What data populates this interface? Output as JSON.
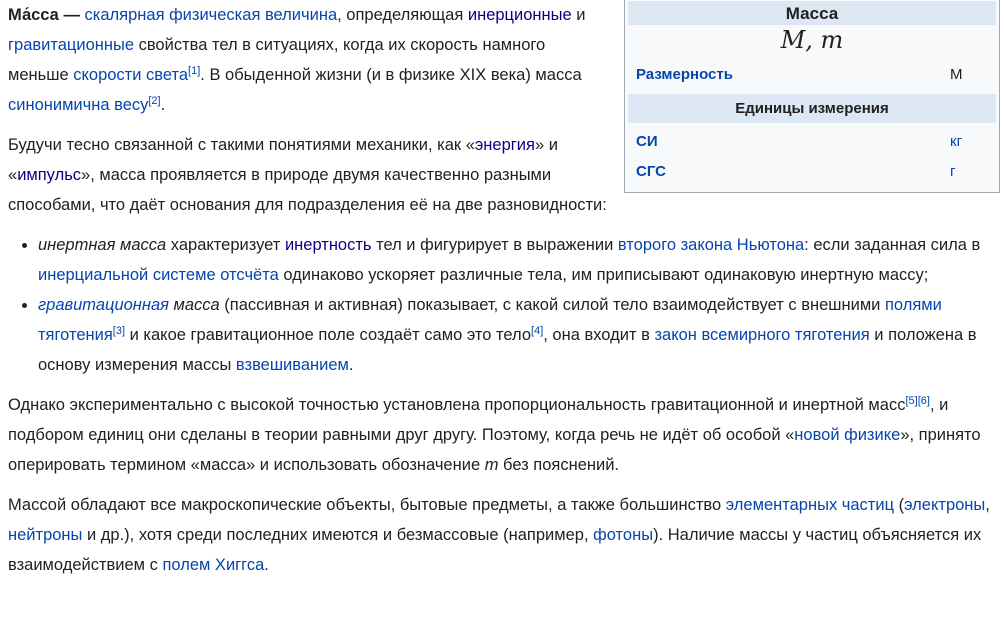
{
  "infobox": {
    "title": "Масса",
    "formula": "M, m",
    "dimension_label": "Размерность",
    "dimension_value": "M",
    "units_header": "Единицы измерения",
    "si_label": "СИ",
    "si_value": "кг",
    "cgs_label": "СГС",
    "cgs_value": "г"
  },
  "p1": {
    "term": "Ма́сса",
    "dash": " — ",
    "link1": "скалярная физическая величина",
    "t1": ", определяющая ",
    "link2": "инерционные",
    "t2": " и ",
    "link3": "гравитационные",
    "t3": " свойства тел в ситуациях, когда их скорость намного меньше ",
    "link4": "скорости света",
    "ref1": "[1]",
    "t4": ". В обыденной жизни (и в физике XIX века) масса ",
    "link5": "синонимична весу",
    "ref2": "[2]",
    "t5": "."
  },
  "p2": {
    "t1": "Будучи тесно связанной с такими понятиями механики, как «",
    "link1": "энергия",
    "t2": "» и «",
    "link2": "импульс",
    "t3": "», масса проявляется в природе двумя качественно разными способами, что даёт основания для подразделения её на две разновидности:"
  },
  "li1": {
    "em": "инертная масса",
    "t1": " характеризует ",
    "link1": "инертность",
    "t2": " тел и фигурирует в выражении ",
    "link2": "второго закона Ньютона",
    "t3": ": если заданная сила в ",
    "link3": "инерциальной системе отсчёта",
    "t4": " одинаково ускоряет различные тела, им приписывают одинаковую инертную массу;"
  },
  "li2": {
    "link_em": "гравитационная",
    "em2": " масса",
    "t1": " (пассивная и активная) показывает, с какой силой тело взаимодействует с внешними ",
    "link1": "полями тяготения",
    "ref3": "[3]",
    "t2": " и какое гравитационное поле создаёт само это тело",
    "ref4": "[4]",
    "t3": ", она входит в ",
    "link2": "закон всемирного тяготения",
    "t4": " и положена в основу измерения массы ",
    "link3": "взвешиванием",
    "t5": "."
  },
  "p3": {
    "t1": "Однако экспериментально с высокой точностью установлена пропорциональность гравитационной и инертной масс",
    "ref5": "[5]",
    "ref6": "[6]",
    "t2": ", и подбором единиц они сделаны в теории равными друг другу. Поэтому, когда речь не идёт об особой «",
    "link1": "новой физике",
    "t3": "», принято оперировать термином «масса» и использовать обозначение ",
    "em": "m",
    "t4": " без пояснений."
  },
  "p4": {
    "t1": "Массой обладают все макроскопические объекты, бытовые предметы, а также большинство ",
    "link1": "элементарных частиц",
    "t2": " (",
    "link2": "электроны",
    "t3": ", ",
    "link3": "нейтроны",
    "t4": " и др.), хотя среди последних имеются и безмассовые (например, ",
    "link4": "фотоны",
    "t5": "). Наличие массы у частиц объясняется их взаимодействием с ",
    "link5": "полем Хиггса",
    "t6": "."
  }
}
